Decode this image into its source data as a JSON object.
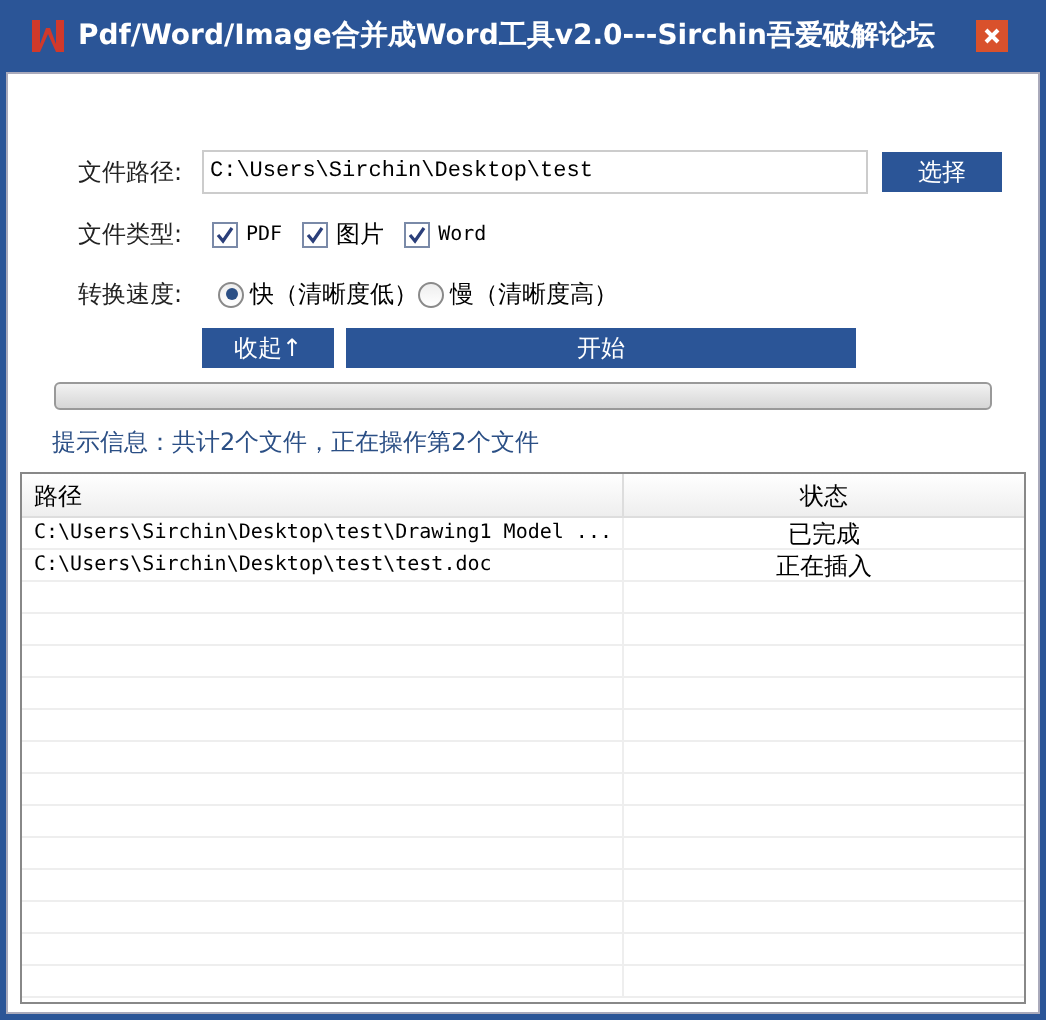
{
  "window": {
    "title": "Pdf/Word/Image合并成Word工具v2.0---Sirchin吾爱破解论坛"
  },
  "path": {
    "label": "文件路径:",
    "value": "C:\\Users\\Sirchin\\Desktop\\test",
    "button": "选择"
  },
  "file_types": {
    "label": "文件类型:",
    "options": [
      {
        "label": "PDF",
        "checked": true
      },
      {
        "label": "图片",
        "checked": true
      },
      {
        "label": "Word",
        "checked": true
      }
    ]
  },
  "speed": {
    "label": "转换速度:",
    "options": [
      {
        "label": "快（清晰度低）",
        "selected": true
      },
      {
        "label": "慢（清晰度高）",
        "selected": false
      }
    ]
  },
  "buttons": {
    "collapse": "收起↑",
    "start": "开始"
  },
  "progress": {
    "level": 0
  },
  "info": "提示信息：共计2个文件，正在操作第2个文件",
  "table": {
    "columns": [
      "路径",
      "状态"
    ],
    "rows": [
      {
        "path": "C:\\Users\\Sirchin\\Desktop\\test\\Drawing1 Model ...",
        "status": "已完成"
      },
      {
        "path": "C:\\Users\\Sirchin\\Desktop\\test\\test.doc",
        "status": "正在插入"
      }
    ]
  }
}
